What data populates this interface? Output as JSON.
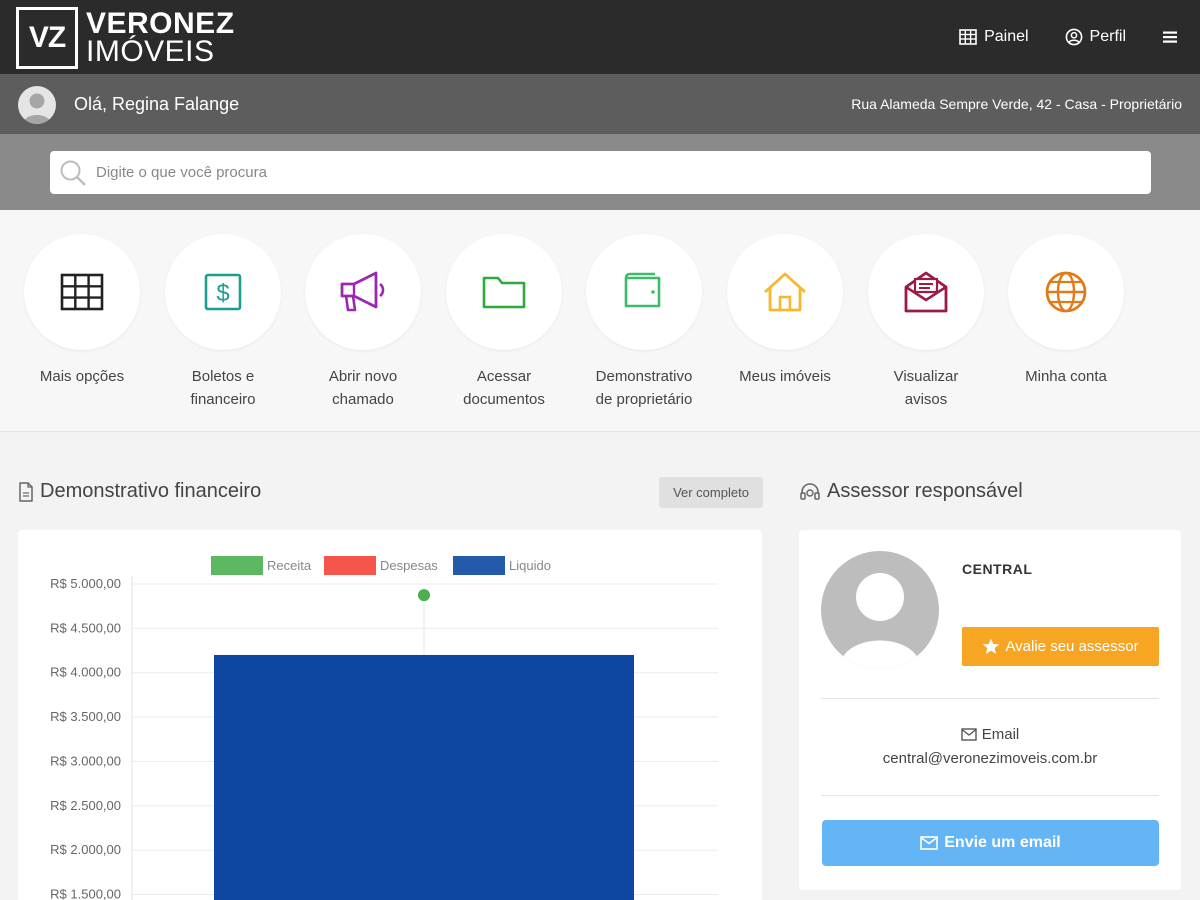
{
  "brand": {
    "logo_mark": "VZ",
    "name_line1": "VERONEZ",
    "name_line2": "IMÓVEIS"
  },
  "topnav": {
    "painel_label": "Painel",
    "painel_icon": "table-icon",
    "perfil_label": "Perfil",
    "perfil_icon": "user-circle-icon",
    "menu_icon": "hamburger-icon"
  },
  "userbar": {
    "greeting": "Olá, Regina Falange",
    "address": "Rua Alameda Sempre Verde, 42 - Casa - Proprietário"
  },
  "search": {
    "placeholder": "Digite o que você procura"
  },
  "shortcuts": [
    {
      "label_line1": "Mais opções",
      "label_line2": "",
      "icon": "grid-icon",
      "color": "#222222"
    },
    {
      "label_line1": "Boletos e",
      "label_line2": "financeiro",
      "icon": "dollar-bill-icon",
      "color": "#1a9e8f"
    },
    {
      "label_line1": "Abrir novo",
      "label_line2": "chamado",
      "icon": "megaphone-icon",
      "color": "#9c27b0"
    },
    {
      "label_line1": "Acessar",
      "label_line2": "documentos",
      "icon": "folder-icon",
      "color": "#2eaa3c"
    },
    {
      "label_line1": "Demonstrativo",
      "label_line2": "de proprietário",
      "icon": "wallet-icon",
      "color": "#3dbb6a"
    },
    {
      "label_line1": "Meus imóveis",
      "label_line2": "",
      "icon": "house-icon",
      "color": "#f5b82e"
    },
    {
      "label_line1": "Visualizar",
      "label_line2": "avisos",
      "icon": "mail-open-icon",
      "color": "#9b1b44"
    },
    {
      "label_line1": "Minha conta",
      "label_line2": "",
      "icon": "globe-icon",
      "color": "#e07b18"
    }
  ],
  "financial": {
    "title": "Demonstrativo financeiro",
    "title_icon": "document-icon",
    "view_full_label": "Ver completo"
  },
  "chart_data": {
    "type": "bar",
    "legend": [
      {
        "name": "Receita",
        "color": "#4caf50"
      },
      {
        "name": "Despesas",
        "color": "#f44336"
      },
      {
        "name": "Liquido",
        "color": "#0d47a1"
      }
    ],
    "y_ticks": [
      "R$ 5.000,00",
      "R$ 4.500,00",
      "R$ 4.000,00",
      "R$ 3.500,00",
      "R$ 3.000,00",
      "R$ 2.500,00",
      "R$ 2.000,00",
      "R$ 1.500,00"
    ],
    "ylim": [
      1500,
      5000
    ],
    "series": [
      {
        "name": "Liquido",
        "type": "bar",
        "values": [
          4200
        ],
        "color": "#0d47a1"
      },
      {
        "name": "Receita",
        "type": "point",
        "values": [
          4875
        ],
        "color": "#4caf50"
      }
    ],
    "grid": true
  },
  "advisor": {
    "title": "Assessor responsável",
    "title_icon": "headset-icon",
    "name": "CENTRAL",
    "rate_label": "Avalie seu assessor",
    "rate_icon": "star-icon",
    "email_label": "Email",
    "email_icon": "envelope-icon",
    "email": "central@veronezimoveis.com.br",
    "send_label": "Envie um email"
  }
}
